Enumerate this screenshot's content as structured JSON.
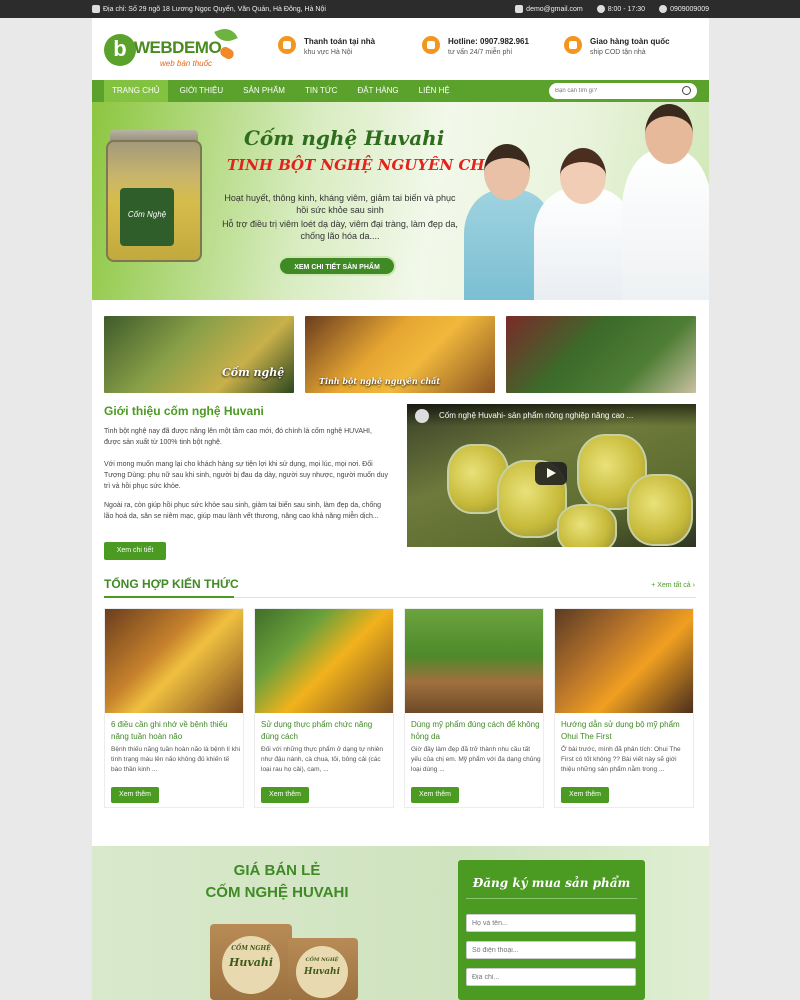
{
  "topbar": {
    "address": "Địa chỉ: Số 29 ngõ 18 Lương Ngọc Quyến, Văn Quán, Hà Đông, Hà Nội",
    "email": "demo@gmail.com",
    "hours": "8:00 - 17:30",
    "phone": "0909009009"
  },
  "logo": {
    "main": "WEBDEMO",
    "sub": "web bán thuốc",
    "letter": "b"
  },
  "header": {
    "payment": {
      "title": "Thanh toán tại nhà",
      "sub": "khu vực Hà Nội"
    },
    "hotline": {
      "title": "Hotline: 0907.982.961",
      "sub": "tư vấn 24/7 miễn phí"
    },
    "shipping": {
      "title": "Giao hàng toàn quốc",
      "sub": "ship COD tận nhà"
    }
  },
  "nav": {
    "items": [
      "Trang chủ",
      "Giới thiệu",
      "Sản phẩm",
      "Tin tức",
      "Đặt hàng",
      "Liên hệ"
    ],
    "search_placeholder": "Bạn cần tìm gì?"
  },
  "banner": {
    "title": "Cốm nghệ Huvahi",
    "subtitle": "TINH BỘT NGHỆ NGUYÊN CHẤT",
    "line1": "Hoạt huyết, thông kinh, kháng viêm, giảm tai biến và phục hồi sức khỏe sau sinh",
    "line2": "Hỗ trợ điều trị viêm loét dạ dày, viêm đại tràng, làm đẹp da, chống lão hóa da....",
    "button": "XEM CHI TIẾT SẢN PHẨM",
    "jar_label": "Cốm Nghệ"
  },
  "categories": [
    {
      "label": "Cốm nghệ"
    },
    {
      "label": "Tinh bột nghệ nguyên chất"
    },
    {
      "label": ""
    }
  ],
  "intro": {
    "title": "Giới thiệu cốm nghệ Huvani",
    "p1": "Tinh bột nghệ nay đã được nâng lên một tầm cao mới, đó chính là cốm nghệ HUVAHI, được sản xuất từ 100% tinh bột nghệ.",
    "p2": "Với mong muốn mang lại cho khách hàng sự tiện lợi khi sử dụng, mọi lúc, mọi nơi. Đối Tượng Dùng: phụ nữ sau khi sinh, người bị đau dạ dày, người suy nhược, người muốn duy trì và hồi phục sức khỏe.",
    "p3": "Ngoài ra, còn giúp hồi phục sức khỏe sau sinh, giảm tai biến sau sinh, làm đẹp da, chống lão hoá da, săn se niêm mạc, giúp mau lành vết thương, nâng cao khả năng miễn dịch...",
    "button": "Xem chi tiết"
  },
  "video": {
    "title": "Cốm nghệ Huvahi- sản phẩm nông nghiệp nâng cao ..."
  },
  "knowledge": {
    "title": "Tổng hợp kiến thức",
    "see_all": "+ Xem tất cả",
    "read_more": "Xem thêm",
    "cards": [
      {
        "title": "6 điều cần ghi nhớ về bệnh thiếu năng tuần hoàn não",
        "desc": "Bệnh thiếu năng tuần hoàn não là bệnh lí khi tình trạng máu lên não không đủ khiến tế bào thần kinh ..."
      },
      {
        "title": "Sử dụng thực phẩm chức năng đúng cách",
        "desc": "Đối với những thực phẩm ở dạng tự nhiên như đậu nành, cà chua, tỏi, bông cải (các loại rau họ cải), cam, ..."
      },
      {
        "title": "Dùng mỹ phẩm đúng cách để không hỏng da",
        "desc": "Giờ đây làm đẹp đã trở thành nhu cầu tất yếu của chị em. Mỹ phẩm với đa dạng chủng loại dùng ..."
      },
      {
        "title": "Hướng dẫn sử dụng bộ mỹ phẩm Ohui The First",
        "desc": "Ở bài trước, mình đã phân tích: Ohui The First có tốt không ?? Bài viết này sẽ giới thiệu những sản phẩm nằm trong ..."
      }
    ]
  },
  "promo": {
    "line1": "GIÁ BÁN LẺ",
    "line2": "CỐM NGHỆ HUVAHI",
    "bag_brand": "Huvahi",
    "bag_top": "CỐM NGHỆ"
  },
  "form": {
    "title": "Đăng ký mua sản phẩm",
    "name_placeholder": "Họ và tên...",
    "phone_placeholder": "Số điện thoại...",
    "address_placeholder": "Địa chỉ..."
  },
  "colors": {
    "primary": "#5aa22b",
    "accent": "#f3961f",
    "red": "#e3231b",
    "dark": "#2c2c2c"
  }
}
